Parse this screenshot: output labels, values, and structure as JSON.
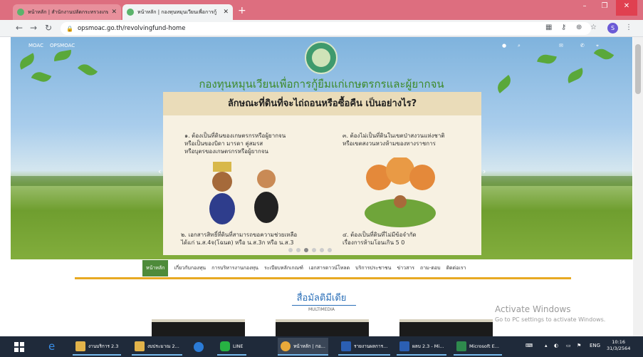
{
  "browser": {
    "tabs": [
      {
        "title": "หน้าหลัก | สำนักงานปลัดกระทรวงเกษ",
        "active": false
      },
      {
        "title": "หน้าหลัก | กองทุนหมุนเวียนเพื่อการกู้",
        "active": true
      }
    ],
    "new_tab": "+",
    "window_controls": {
      "minimize": "–",
      "maximize": "❐",
      "close": "✕"
    },
    "url": "opsmoac.go.th/revolvingfund-home",
    "profile_initial": "S"
  },
  "site": {
    "top_links": [
      "MOAC",
      "OPSMOAC"
    ],
    "org_name": "กองทุนหมุนเวียนเพื่อการกู้ยืมแก่เกษตรกรและผู้ยากจน",
    "slide": {
      "heading": "ลักษณะที่ดินที่จะไถ่ถอนหรือซื้อคืน เป็นอย่างไร?",
      "item1": "๑. ต้องเป็นที่ดินของเกษตรกรหรือผู้ยากจน\nหรือเป็นของบิดา มารดา คู่สมรส\nหรือบุตรของเกษตรกรหรือผู้ยากจน",
      "item2": "๒. เอกสารสิทธิ์ที่ดินที่สามารถขอความช่วยเหลือ\nได้แก่ น.ส.4จ(โฉนด) หรือ น.ส.3ก หรือ น.ส.3",
      "item3": "๓. ต้องไม่เป็นที่ดินในเขตป่าสงวนแห่งชาติ\nหรือเขตสงวนหวงห้ามของทางราชการ",
      "item4": "๔. ต้องเป็นที่ดินที่ไม่มีข้อจำกัด\nเรื่องการห้ามโอนเกิน 5 0"
    },
    "menu": [
      "หน้าหลัก",
      "เกี่ยวกับกองทุน",
      "การบริหารงานกองทุน",
      "ระเบียบหลักเกณฑ์",
      "เอกสารดาวน์โหลด",
      "บริการประชาชน",
      "ข่าวสาร",
      "ถาม-ตอบ",
      "ติดต่อเรา"
    ],
    "multimedia_title": "สื่อมัลติมีเดีย",
    "multimedia_sub": "MULTIMEDIA"
  },
  "watermark": {
    "line1": "Activate Windows",
    "line2": "Go to PC settings to activate Windows."
  },
  "taskbar": {
    "items": [
      {
        "label": "งานบริการ 2.3",
        "color": "#e2b34a"
      },
      {
        "label": "งบประมาณ 2...",
        "color": "#e2b34a"
      },
      {
        "label": "",
        "color": "#2b7bd6"
      },
      {
        "label": "LINE",
        "color": "#27b243"
      },
      {
        "label": "หน้าหลัก | กอ...",
        "color": "#e9a93a"
      },
      {
        "label": "รายงานผลการ...",
        "color": "#2b5fb3"
      },
      {
        "label": "ผลบ 2.3 - Mi...",
        "color": "#2b5fb3"
      },
      {
        "label": "Microsoft E...",
        "color": "#2e8a4d"
      }
    ],
    "lang": "ENG",
    "time": "10:16",
    "date": "31/3/2564"
  }
}
